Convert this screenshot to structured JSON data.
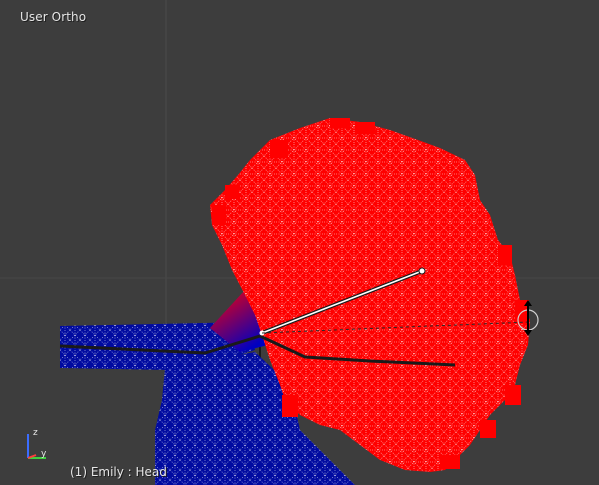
{
  "viewport": {
    "view_label": "User Ortho",
    "object_label": "(1) Emily : Head"
  },
  "gizmo": {
    "z_label": "z",
    "y_label": "y"
  },
  "colors": {
    "background": "#3d3d3d",
    "grid_line": "#4a4a4a",
    "weight_high": "#ff0000",
    "weight_low": "#0000a0",
    "wire": "#ffffff",
    "bone": "#1a1a1a"
  }
}
